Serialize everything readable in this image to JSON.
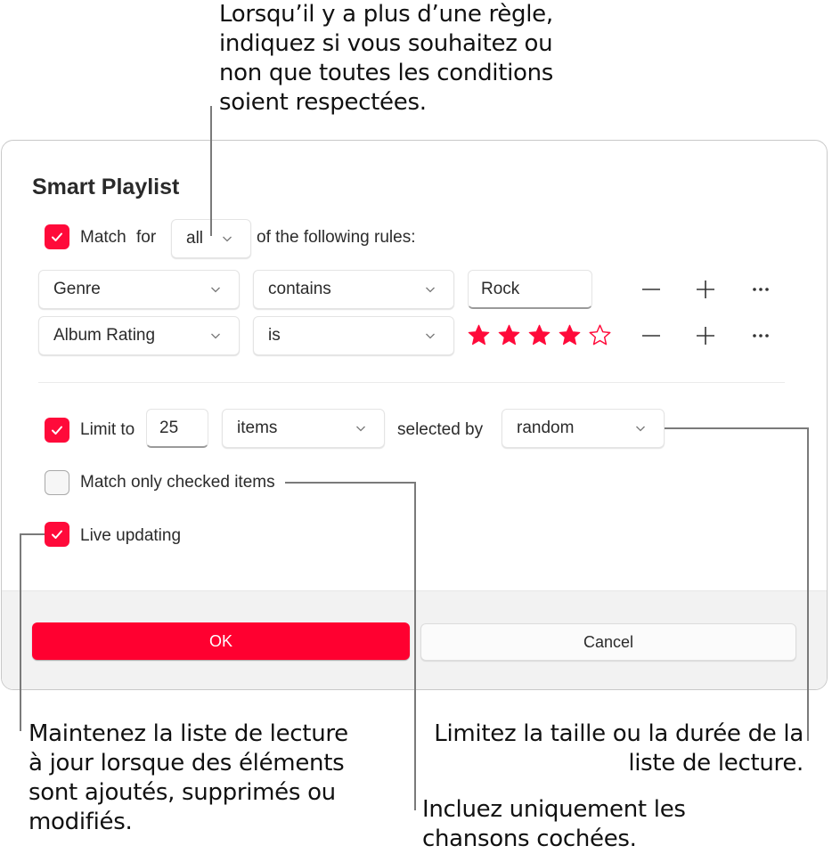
{
  "annotations": {
    "match_rule": "Lorsqu’il y a plus d’une règle, indiquez si vous souhaitez ou non que toutes les conditions soient respectées.",
    "live_updating": "Maintenez la liste de lecture à jour lorsque des éléments sont ajoutés, supprimés ou modifiés.",
    "limit": "Limitez la taille ou la durée de la liste de lecture.",
    "checked_only": "Incluez uniquement les chansons cochées."
  },
  "dialog": {
    "title": "Smart Playlist",
    "match": {
      "checked": true,
      "label": "Match",
      "for_label": "for",
      "selector_value": "all",
      "suffix": "of the following rules:"
    },
    "rules": [
      {
        "field": "Genre",
        "operator": "contains",
        "value": "Rock"
      },
      {
        "field": "Album Rating",
        "operator": "is",
        "rating": 4,
        "rating_max": 5
      }
    ],
    "rule_actions": {
      "remove": "remove-rule",
      "add": "add-rule",
      "more": "more-options"
    },
    "limit": {
      "checked": true,
      "label": "Limit to",
      "amount": "25",
      "unit": "items",
      "selected_by_label": "selected by",
      "selected_by": "random"
    },
    "match_checked": {
      "checked": false,
      "label": "Match only checked items"
    },
    "live_updating": {
      "checked": true,
      "label": "Live updating"
    },
    "buttons": {
      "ok": "OK",
      "cancel": "Cancel"
    }
  },
  "colors": {
    "accent": "#ff0a3a",
    "ok_button": "#ff0030"
  }
}
